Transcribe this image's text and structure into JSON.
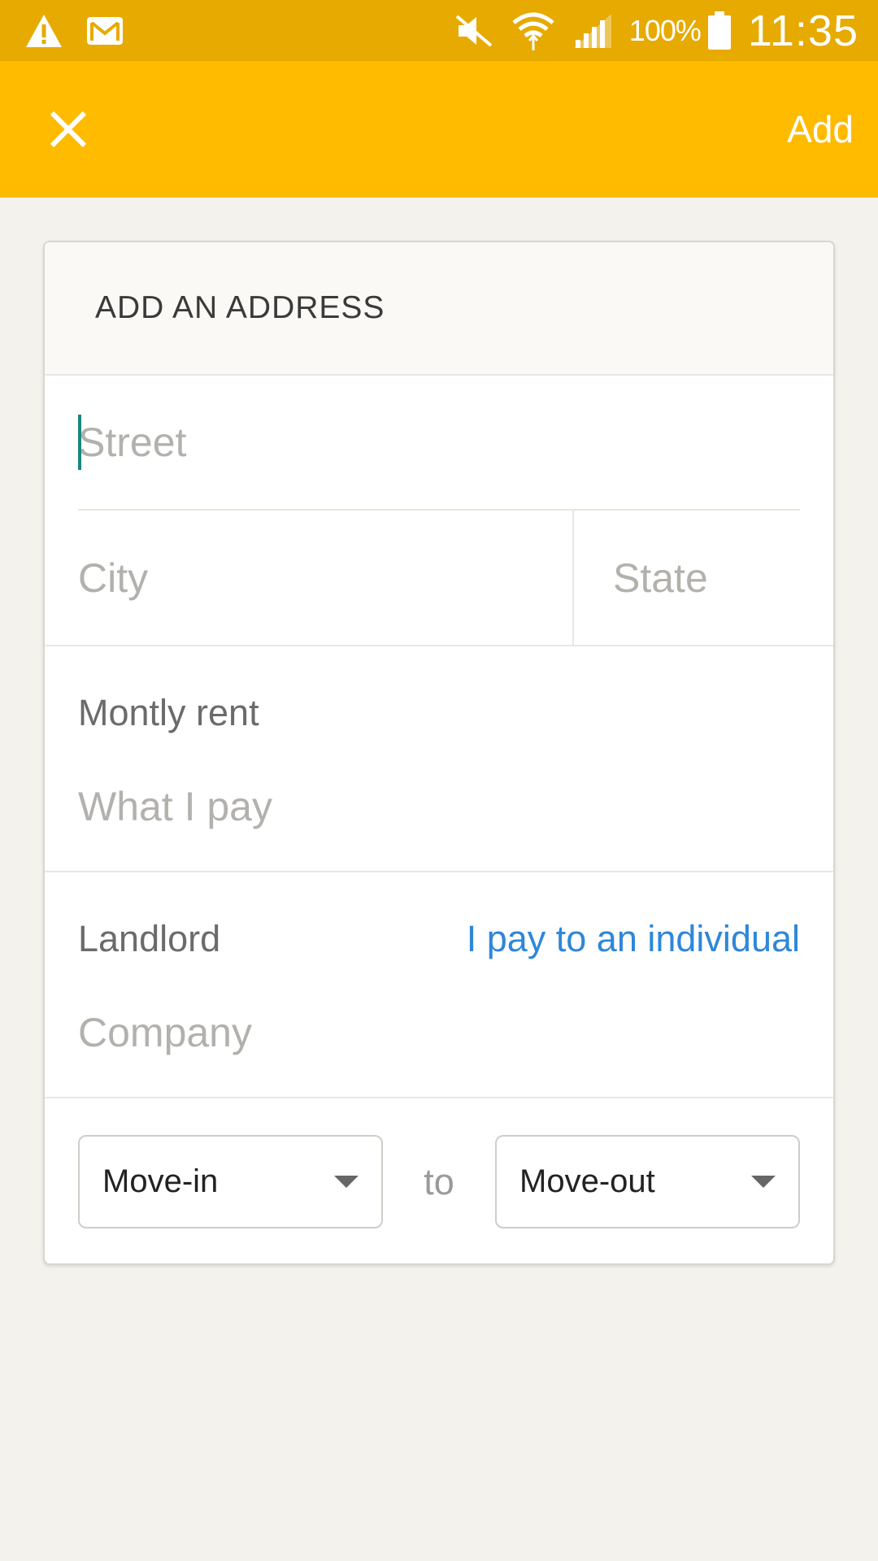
{
  "status_bar": {
    "icons_left": [
      "warning-icon",
      "gmail-icon"
    ],
    "icons_right": [
      "mute-icon",
      "wifi-icon",
      "signal-icon"
    ],
    "battery": "100%",
    "time": "11:35"
  },
  "app_bar": {
    "close_icon": "close-icon",
    "add_label": "Add",
    "color": "#ffbb00"
  },
  "form": {
    "title": "ADD AN ADDRESS",
    "street_placeholder": "Street",
    "city_placeholder": "City",
    "state_placeholder": "State",
    "rent": {
      "label": "Montly rent",
      "placeholder": "What I pay"
    },
    "landlord": {
      "label": "Landlord",
      "link": "I pay to an individual",
      "placeholder": "Company"
    },
    "dates": {
      "move_in": "Move-in",
      "separator": "to",
      "move_out": "Move-out"
    }
  },
  "colors": {
    "accent_link": "#2f87d8",
    "cursor": "#15897d",
    "status_bar": "#e6aa00"
  }
}
